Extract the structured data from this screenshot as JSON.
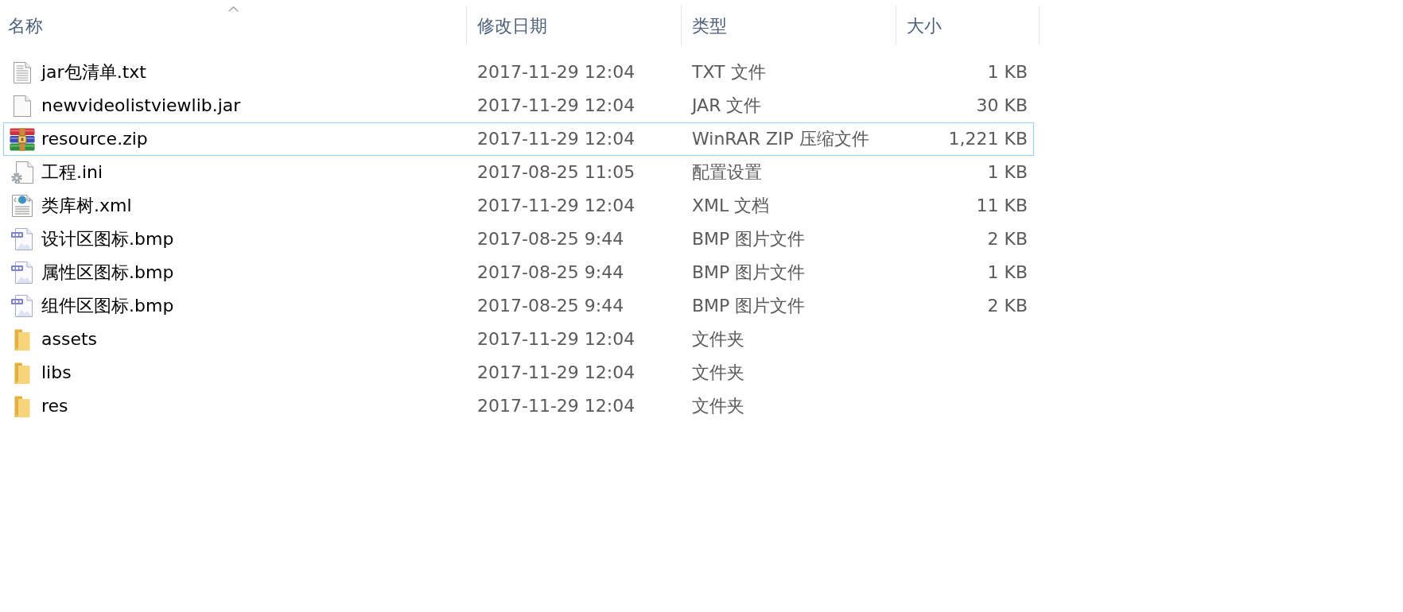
{
  "table": {
    "columns": [
      {
        "label": "名称",
        "sorted": true
      },
      {
        "label": "修改日期",
        "sorted": false
      },
      {
        "label": "类型",
        "sorted": false
      },
      {
        "label": "大小",
        "sorted": false
      }
    ],
    "rows": [
      {
        "kind": "text",
        "name": "jar包清单.txt",
        "modified": "2017-11-29 12:04",
        "type": "TXT 文件",
        "size": "1 KB",
        "focused": false
      },
      {
        "kind": "blank",
        "name": "newvideolistviewlib.jar",
        "modified": "2017-11-29 12:04",
        "type": "JAR 文件",
        "size": "30 KB",
        "focused": false
      },
      {
        "kind": "archive",
        "name": "resource.zip",
        "modified": "2017-11-29 12:04",
        "type": "WinRAR ZIP 压缩文件",
        "size": "1,221 KB",
        "focused": true
      },
      {
        "kind": "settings",
        "name": "工程.ini",
        "modified": "2017-08-25 11:05",
        "type": "配置设置",
        "size": "1 KB",
        "focused": false
      },
      {
        "kind": "xml",
        "name": "类库树.xml",
        "modified": "2017-11-29 12:04",
        "type": "XML 文档",
        "size": "11 KB",
        "focused": false
      },
      {
        "kind": "bitmap",
        "name": "设计区图标.bmp",
        "modified": "2017-08-25 9:44",
        "type": "BMP 图片文件",
        "size": "2 KB",
        "focused": false
      },
      {
        "kind": "bitmap",
        "name": "属性区图标.bmp",
        "modified": "2017-08-25 9:44",
        "type": "BMP 图片文件",
        "size": "1 KB",
        "focused": false
      },
      {
        "kind": "bitmap",
        "name": "组件区图标.bmp",
        "modified": "2017-08-25 9:44",
        "type": "BMP 图片文件",
        "size": "2 KB",
        "focused": false
      },
      {
        "kind": "folder",
        "name": "assets",
        "modified": "2017-11-29 12:04",
        "type": "文件夹",
        "focused": false
      },
      {
        "kind": "folder",
        "name": "libs",
        "modified": "2017-11-29 12:04",
        "type": "文件夹",
        "focused": false
      },
      {
        "kind": "folder",
        "name": "res",
        "modified": "2017-11-29 12:04",
        "type": "文件夹",
        "focused": false
      }
    ]
  }
}
